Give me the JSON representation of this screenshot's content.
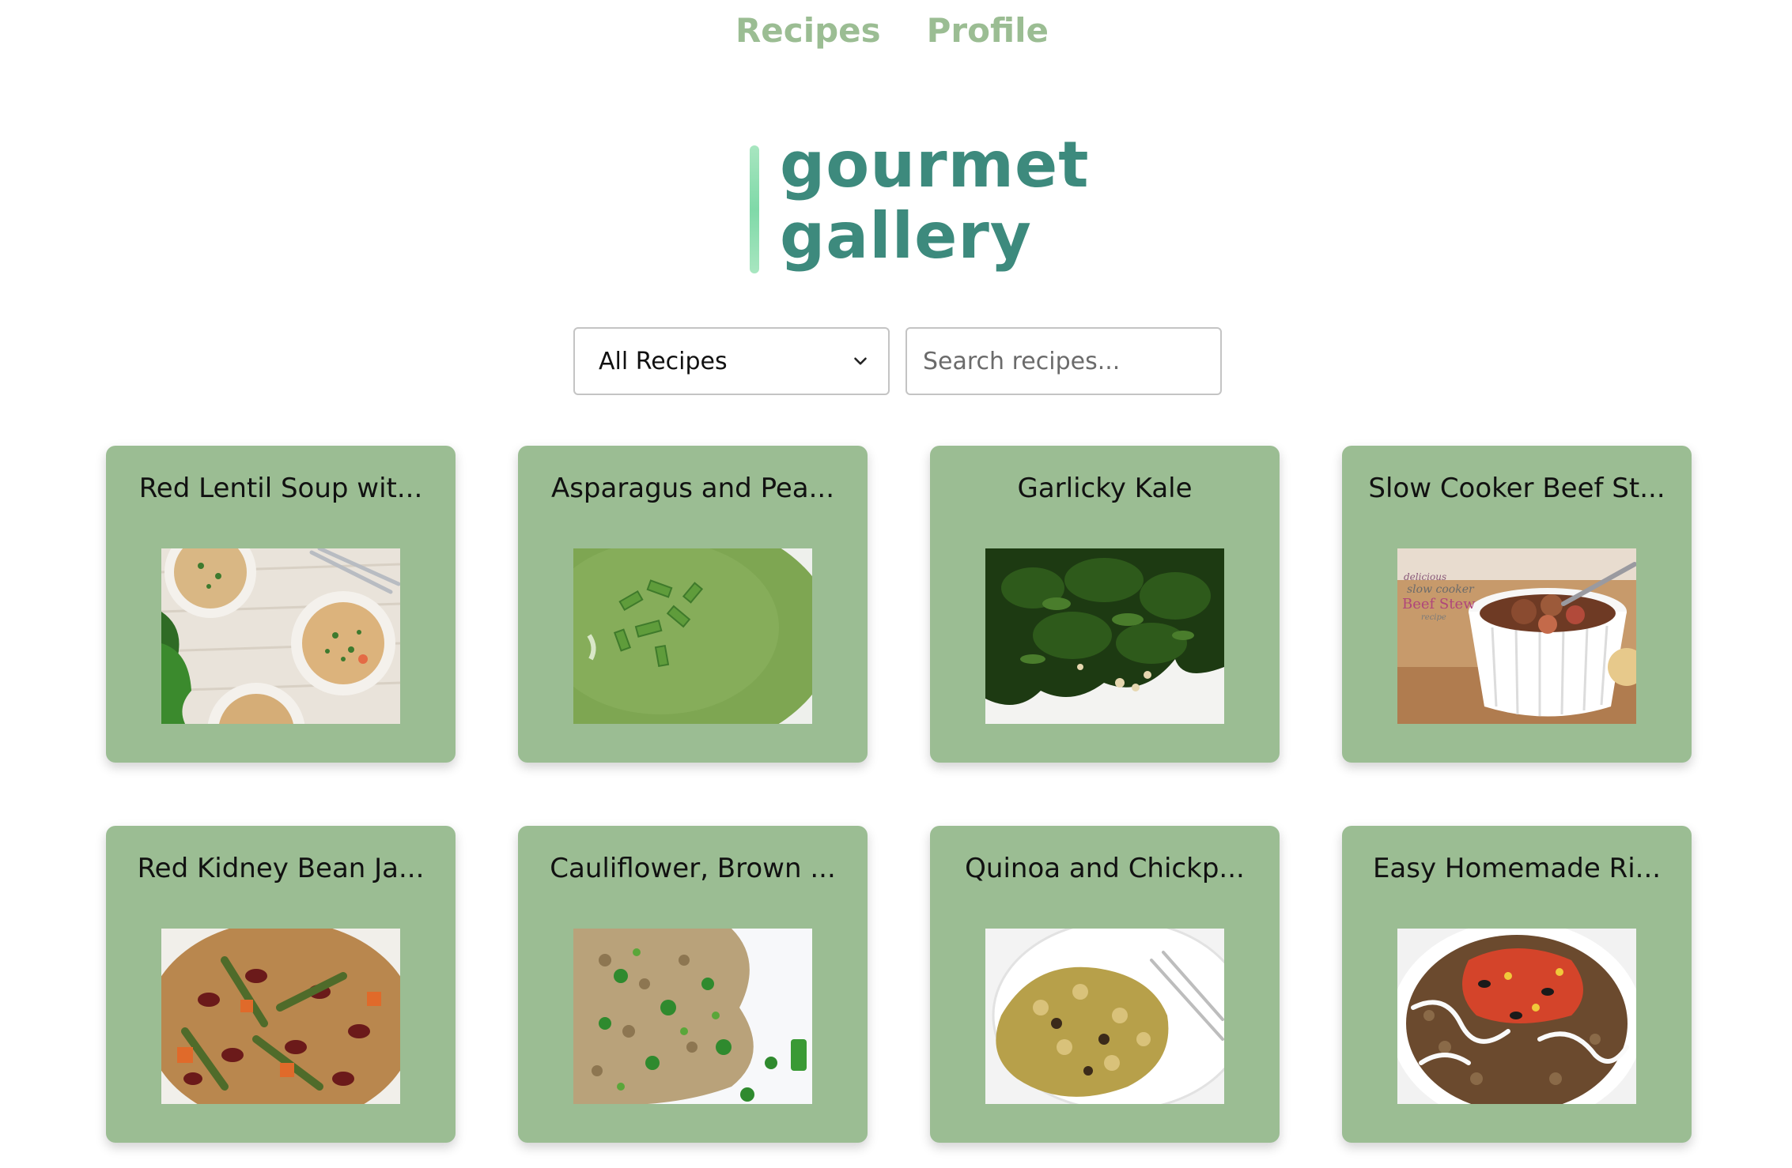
{
  "nav": {
    "recipes_label": "Recipes",
    "profile_label": "Profile"
  },
  "logo": {
    "line1": "gourmet",
    "line2": "gallery"
  },
  "filters": {
    "category_selected": "All Recipes",
    "search_placeholder": "Search recipes..."
  },
  "colors": {
    "nav": "#9bbd93",
    "card_bg": "#9bbd93",
    "logo_text": "#3d8a7d",
    "logo_bar": "#7fd9a8"
  },
  "recipes": [
    {
      "title": "Red Lentil Soup wit...",
      "image": "lentil-soup-bowls"
    },
    {
      "title": "Asparagus and Pea...",
      "image": "green-soup"
    },
    {
      "title": "Garlicky Kale",
      "image": "sauteed-kale"
    },
    {
      "title": "Slow Cooker Beef St...",
      "image": "beef-stew-ramekin"
    },
    {
      "title": "Red Kidney Bean Ja...",
      "image": "kidney-bean-jambalaya"
    },
    {
      "title": "Cauliflower, Brown ...",
      "image": "cauliflower-rice"
    },
    {
      "title": "Quinoa and Chickp...",
      "image": "quinoa-chickpea"
    },
    {
      "title": "Easy Homemade Ri...",
      "image": "rice-bowl-salsa"
    }
  ],
  "image_text": {
    "beef_stew_overlay_1": "delicious",
    "beef_stew_overlay_2": "slow cooker",
    "beef_stew_overlay_3": "Beef Stew",
    "beef_stew_overlay_4": "recipe"
  }
}
